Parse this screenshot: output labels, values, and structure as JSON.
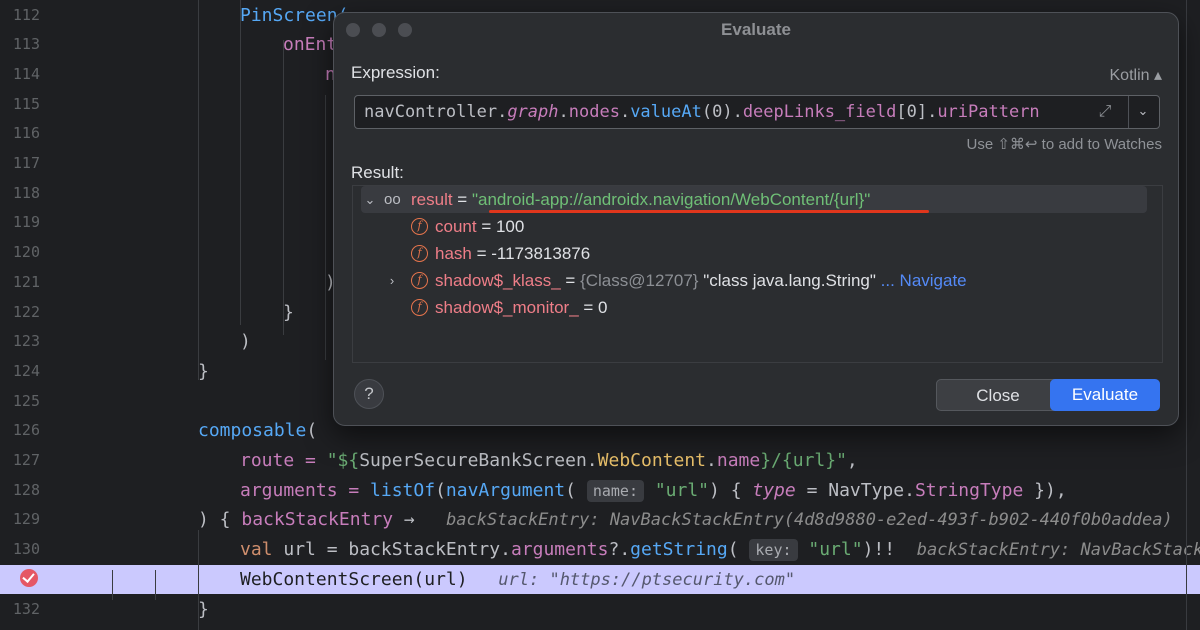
{
  "editor": {
    "lines": [
      {
        "num": "112",
        "code": [
          [
            "PinScreen(",
            "fn"
          ]
        ]
      },
      {
        "num": "113",
        "code": [
          [
            "onEnt",
            "nm"
          ]
        ]
      },
      {
        "num": "114",
        "code": [
          [
            "n",
            "nm"
          ]
        ]
      },
      {
        "num": "115",
        "code": []
      },
      {
        "num": "116",
        "code": []
      },
      {
        "num": "117",
        "code": []
      },
      {
        "num": "118",
        "code": []
      },
      {
        "num": "119",
        "code": []
      },
      {
        "num": "120",
        "code": []
      },
      {
        "num": "121",
        "code": [
          [
            ")",
            ""
          ]
        ]
      },
      {
        "num": "122",
        "code": [
          [
            "}",
            ""
          ]
        ]
      },
      {
        "num": "123",
        "code": [
          [
            ")",
            ""
          ]
        ]
      },
      {
        "num": "124",
        "code": [
          [
            "}",
            ""
          ]
        ]
      },
      {
        "num": "125",
        "code": []
      },
      {
        "num": "126",
        "code": [
          [
            "composable",
            "fn"
          ],
          [
            "(",
            ""
          ]
        ]
      },
      {
        "num": "127",
        "code": [
          [
            "route = ",
            "nm"
          ],
          [
            "\"${",
            "str"
          ],
          [
            "SuperSecureBankScreen",
            ""
          ],
          [
            ".",
            ""
          ],
          [
            "WebContent",
            "cls"
          ],
          [
            ".",
            ""
          ],
          [
            "name",
            "nm"
          ],
          [
            "}/{url}\"",
            "str"
          ],
          [
            ",",
            ""
          ]
        ]
      },
      {
        "num": "128",
        "code": [
          [
            "arguments = ",
            "nm"
          ],
          [
            "listOf",
            "fn"
          ],
          [
            "(",
            ""
          ],
          [
            "navArgument",
            "fn"
          ],
          [
            "( ",
            ""
          ],
          [
            "name:",
            "chip"
          ],
          [
            " ",
            ""
          ],
          [
            "\"url\"",
            "str"
          ],
          [
            ") { ",
            ""
          ],
          [
            "type",
            "it"
          ],
          [
            " = ",
            ""
          ],
          [
            "NavType",
            ""
          ],
          [
            ".",
            ""
          ],
          [
            "StringType",
            "nm"
          ],
          [
            " }),",
            ""
          ]
        ]
      },
      {
        "num": "129",
        "code": [
          [
            ") { ",
            ""
          ],
          [
            "backStackEntry",
            "nm"
          ],
          [
            " → ",
            ""
          ],
          [
            "  backStackEntry: NavBackStackEntry(4d8d9880-e2ed-493f-b902-440f0b0addea)",
            "hint"
          ]
        ]
      },
      {
        "num": "130",
        "code": [
          [
            "val ",
            "kw"
          ],
          [
            "url = backStackEntry.",
            ""
          ],
          [
            "arguments",
            "nm"
          ],
          [
            "?.",
            ""
          ],
          [
            "getString",
            "fn"
          ],
          [
            "( ",
            ""
          ],
          [
            "key:",
            "chip"
          ],
          [
            " ",
            ""
          ],
          [
            "\"url\"",
            "str"
          ],
          [
            ")!!  ",
            ""
          ],
          [
            "backStackEntry: NavBackStackEntry",
            "hint"
          ]
        ]
      },
      {
        "num": "",
        "code": [
          [
            "WebContentScreen(url)",
            ""
          ],
          [
            "   url: \"https://ptsecurity.com\"",
            "hint"
          ]
        ]
      },
      {
        "num": "132",
        "code": [
          [
            "}",
            ""
          ]
        ]
      }
    ]
  },
  "dialog": {
    "title": "Evaluate",
    "expression_label": "Expression:",
    "language": "Kotlin ▴",
    "expression_parts": [
      [
        "navController",
        ""
      ],
      [
        ".",
        ""
      ],
      [
        "graph",
        "it"
      ],
      [
        ".",
        ""
      ],
      [
        "nodes",
        "nm"
      ],
      [
        ".",
        ""
      ],
      [
        "valueAt",
        "fn"
      ],
      [
        "(0)",
        ""
      ],
      [
        ".",
        ""
      ],
      [
        "deepLinks_field",
        "nm"
      ],
      [
        "[0]",
        ""
      ],
      [
        ".",
        ""
      ],
      [
        "uriPattern",
        "nm"
      ]
    ],
    "watch_hint": "Use ⇧⌘↩ to add to Watches",
    "result_label": "Result:",
    "result": {
      "name": "result",
      "eq": " = ",
      "value": "\"android-app://androidx.navigation/WebContent/{url}\""
    },
    "fields": [
      {
        "name": "count",
        "eq": " = ",
        "value": "100",
        "extra": "",
        "link": ""
      },
      {
        "name": "hash",
        "eq": " = ",
        "value": "-1173813876",
        "extra": "",
        "link": ""
      },
      {
        "name": "shadow$_klass_",
        "eq": " = ",
        "value": "{Class@12707}",
        "extra": " \"class java.lang.String\"",
        "link": " ... Navigate"
      },
      {
        "name": "shadow$_monitor_",
        "eq": " = ",
        "value": "0",
        "extra": "",
        "link": ""
      }
    ],
    "help": "?",
    "close": "Close",
    "evaluate": "Evaluate"
  },
  "colors": {
    "accent": "#3574f0",
    "underline": "#e0361c",
    "breakpoint": "#e55765",
    "highlight": "#cbc9fe"
  }
}
